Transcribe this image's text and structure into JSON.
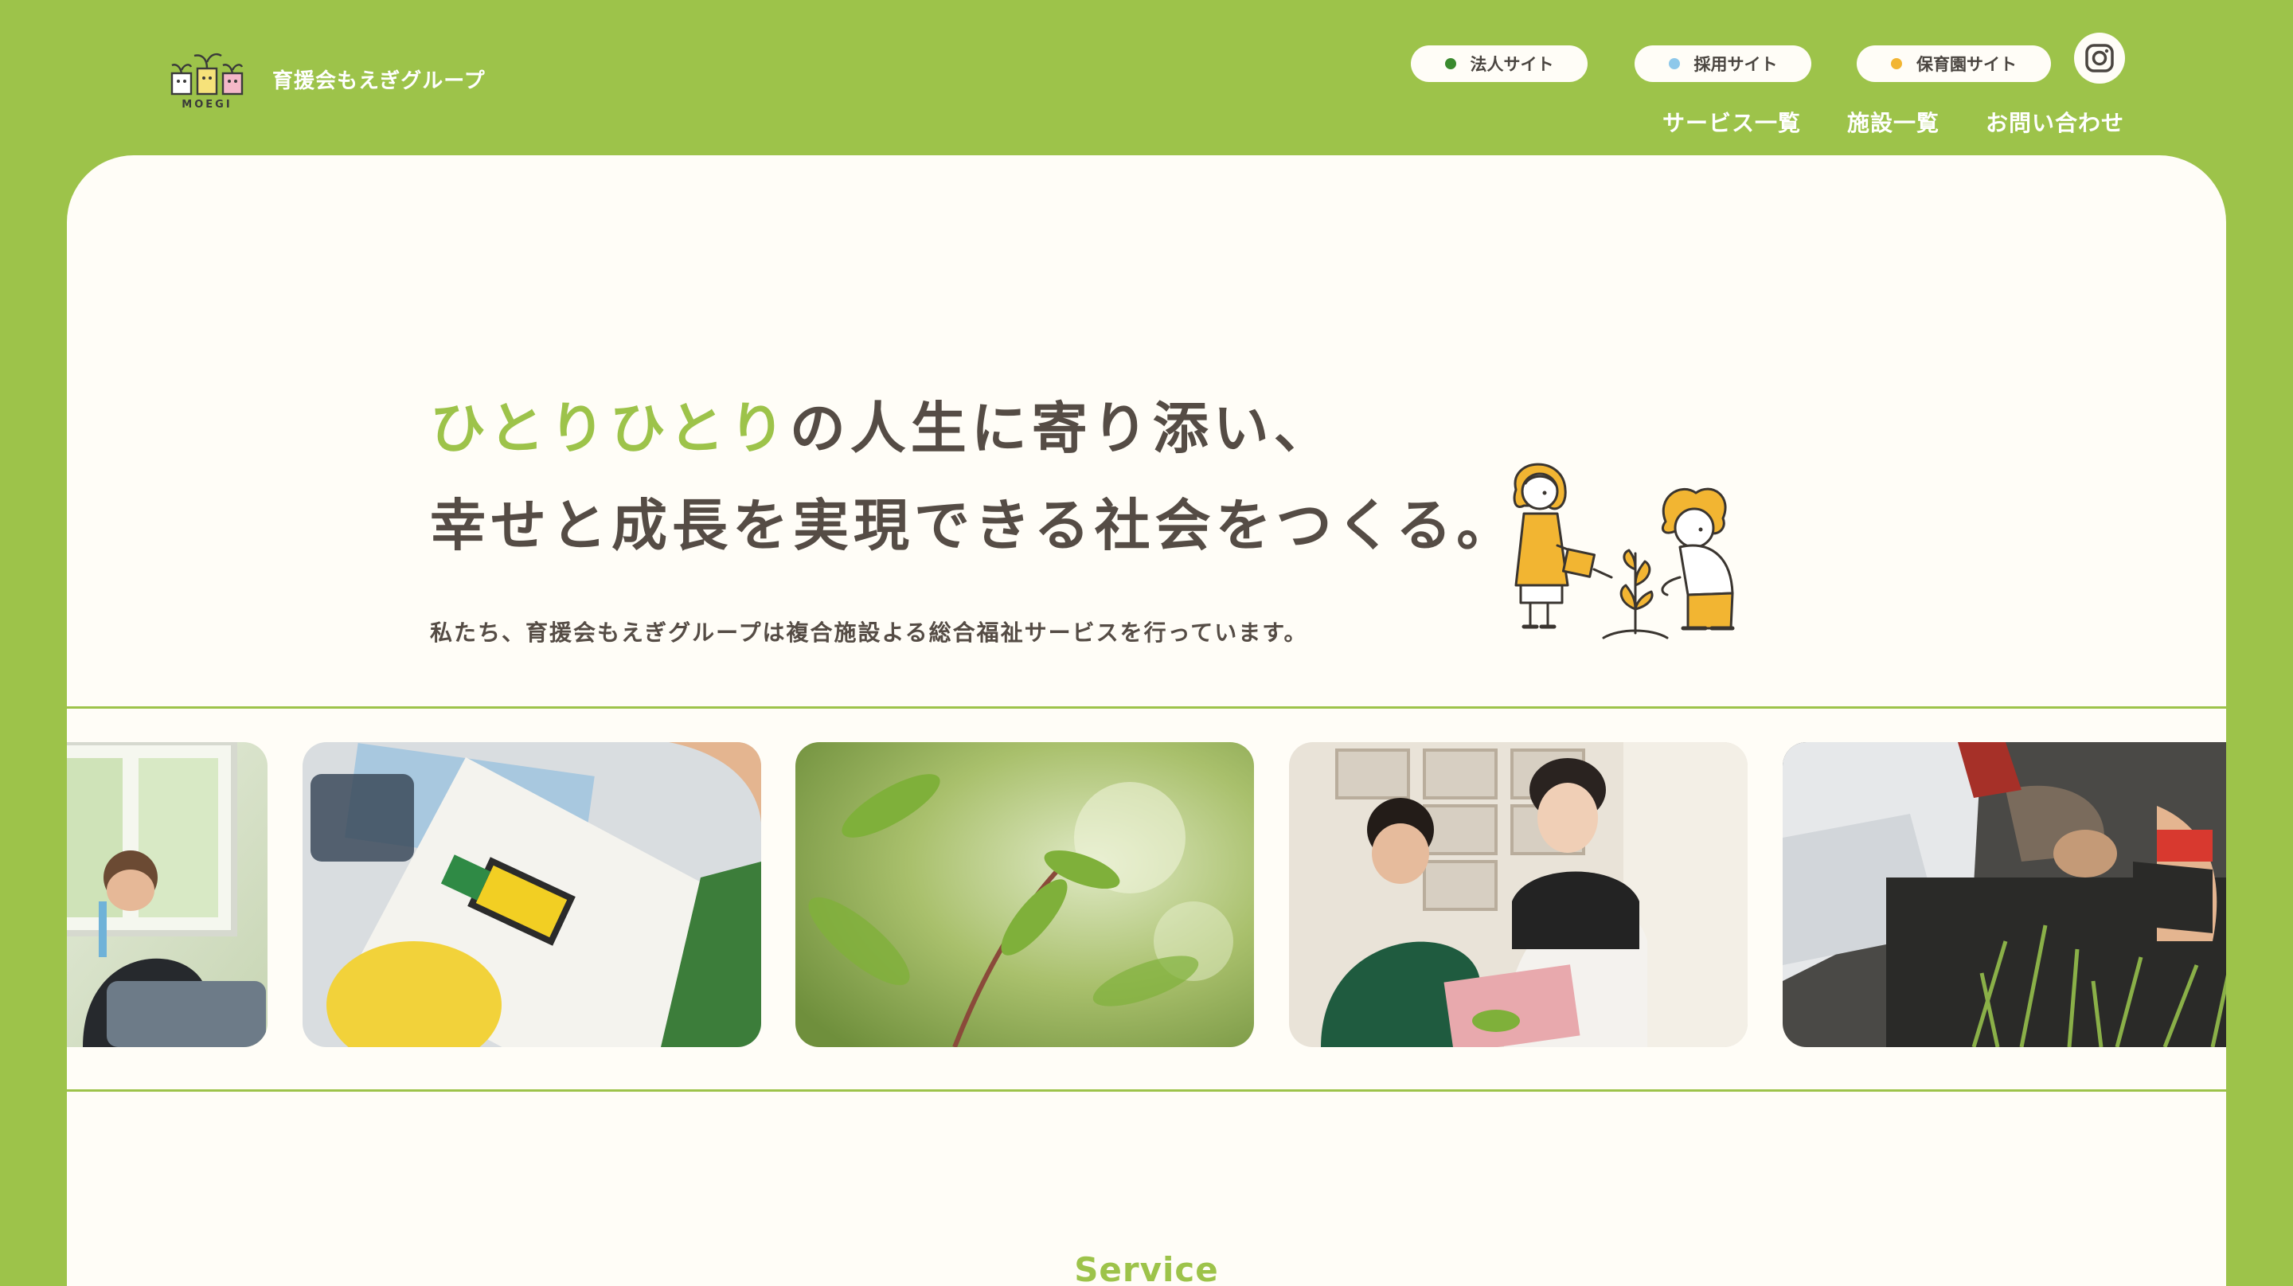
{
  "header": {
    "logo_text": "育援会もえぎグループ",
    "logo_mark_letters": "MOEGI",
    "pills": [
      {
        "label": "法人サイト",
        "dot_color": "#3a8a2e"
      },
      {
        "label": "採用サイト",
        "dot_color": "#8ec8ea"
      },
      {
        "label": "保育園サイト",
        "dot_color": "#f2b532"
      }
    ],
    "instagram_icon": "instagram-icon",
    "nav": [
      "サービス一覧",
      "施設一覧",
      "お問い合わせ"
    ]
  },
  "hero": {
    "title_accent": "ひとりひとり",
    "title_rest": "の人生に寄り添い、",
    "title_line2": "幸せと成長を実現できる社会をつくる。",
    "subtitle": "私たち、育援会もえぎグループは複合施設よる総合福祉サービスを行っています。"
  },
  "photos": [
    "boy-at-desk-photo",
    "bead-craft-photo",
    "leaves-photo",
    "child-and-staff-photo",
    "gardening-photo"
  ],
  "sections": {
    "service_title": "Service"
  },
  "colors": {
    "brand_green": "#9dc34a",
    "text_brown": "#554c45",
    "card_bg": "#fffdf7",
    "illust_yellow": "#f2b532"
  }
}
